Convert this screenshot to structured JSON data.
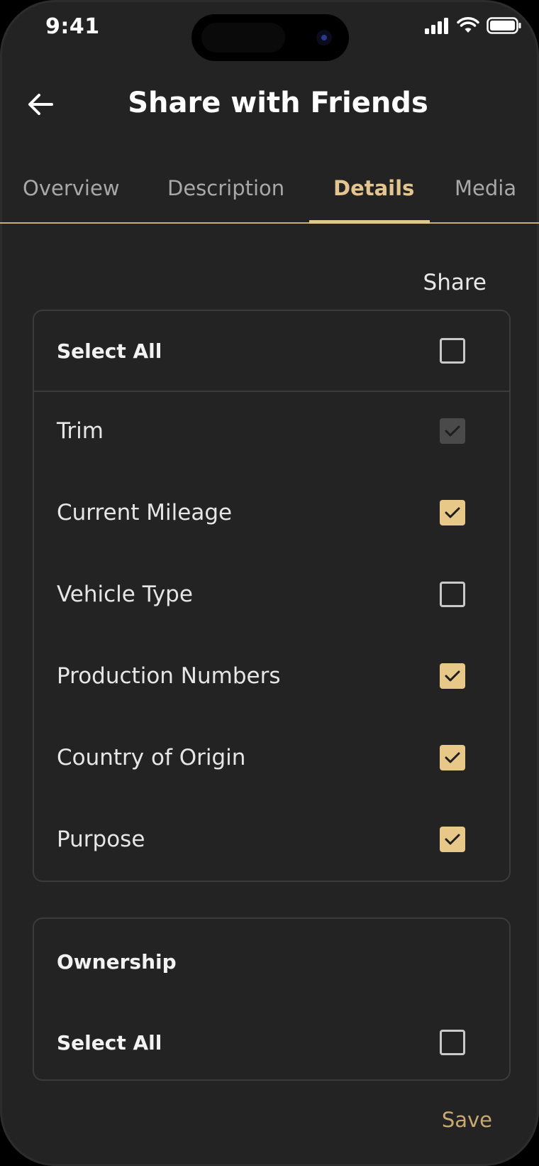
{
  "status": {
    "time": "9:41"
  },
  "header": {
    "title": "Share with Friends"
  },
  "tabs": [
    {
      "label": "Overview",
      "active": false
    },
    {
      "label": "Description",
      "active": false
    },
    {
      "label": "Details",
      "active": true
    },
    {
      "label": "Media",
      "active": false
    }
  ],
  "share_column_label": "Share",
  "details_card": {
    "select_all": {
      "label": "Select All",
      "state": "unchecked"
    },
    "items": [
      {
        "label": "Trim",
        "state": "checked-disabled"
      },
      {
        "label": "Current Mileage",
        "state": "checked"
      },
      {
        "label": "Vehicle Type",
        "state": "unchecked"
      },
      {
        "label": "Production Numbers",
        "state": "checked"
      },
      {
        "label": "Country of Origin",
        "state": "checked"
      },
      {
        "label": "Purpose",
        "state": "checked"
      }
    ]
  },
  "ownership_card": {
    "title": "Ownership",
    "select_all": {
      "label": "Select All",
      "state": "unchecked"
    }
  },
  "footer": {
    "save_label": "Save"
  },
  "colors": {
    "background": "#232323",
    "accent": "#e3c58f",
    "checkbox_checked": "#e8c888",
    "checkbox_disabled": "#4a4a4a"
  }
}
